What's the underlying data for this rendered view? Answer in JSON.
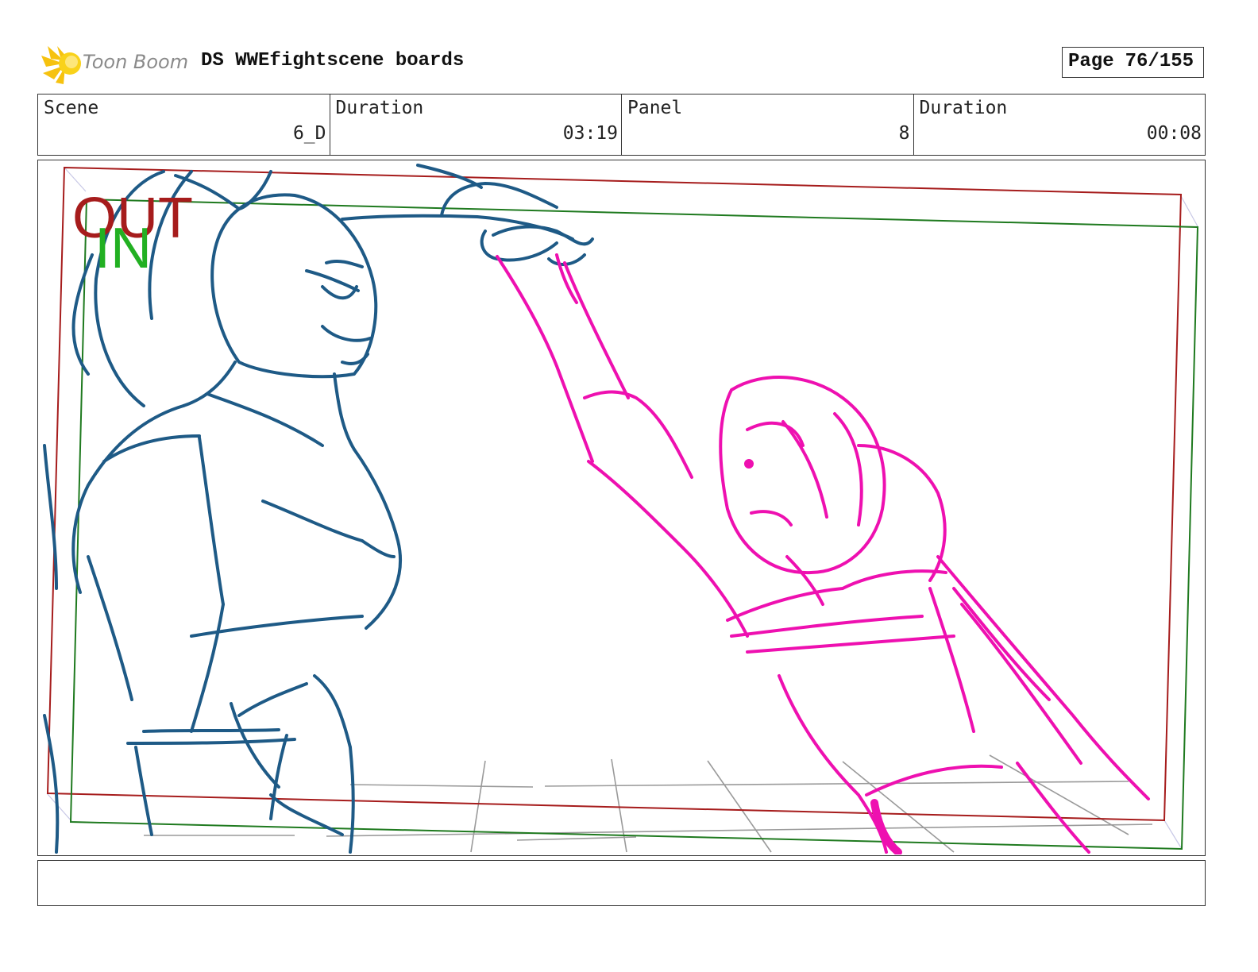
{
  "header": {
    "logo_text": "Toon Boom",
    "project_title": "DS WWEfightscene boards",
    "page_label": "Page",
    "page_number": "76/155"
  },
  "info": {
    "scene_label": "Scene",
    "scene_value": "6_D",
    "scene_duration_label": "Duration",
    "scene_duration_value": "03:19",
    "panel_label": "Panel",
    "panel_value": "8",
    "panel_duration_label": "Duration",
    "panel_duration_value": "00:08"
  },
  "panel": {
    "out_label": "OUT",
    "in_label": "IN",
    "colors": {
      "out_frame": "#a61c1c",
      "in_frame": "#1f7a1f",
      "in_text": "#22b022",
      "character_left": "#1e5a86",
      "character_right": "#ee10b0",
      "floor_grid": "#9a9a9a"
    }
  },
  "notes": {
    "text": ""
  }
}
